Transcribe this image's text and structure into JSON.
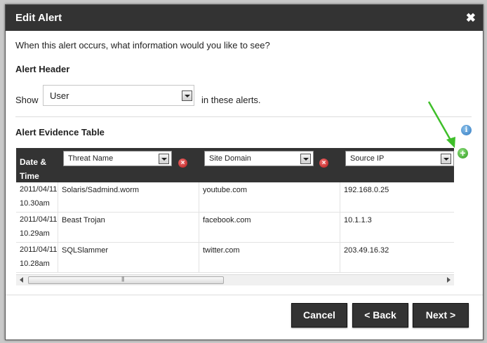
{
  "dialog": {
    "title": "Edit Alert",
    "close_label": "✖",
    "prompt": "When this alert occurs, what information would you like to see?"
  },
  "alert_header": {
    "title": "Alert Header",
    "show_label": "Show",
    "selected": "User",
    "after_label": "in these alerts."
  },
  "evidence_table": {
    "title": "Alert Evidence Table",
    "date_header": "Date & Time",
    "columns": [
      "Threat Name",
      "Site Domain",
      "Source IP"
    ],
    "rows": [
      {
        "date": "2011/04/11",
        "time": "10.30am",
        "threat": "Solaris/Sadmind.worm",
        "domain": "youtube.com",
        "ip": "192.168.0.25"
      },
      {
        "date": "2011/04/11",
        "time": "10.29am",
        "threat": "Beast Trojan",
        "domain": "facebook.com",
        "ip": "10.1.1.3"
      },
      {
        "date": "2011/04/11",
        "time": "10.28am",
        "threat": "SQLSlammer",
        "domain": "twitter.com",
        "ip": "203.49.16.32"
      }
    ]
  },
  "buttons": {
    "cancel": "Cancel",
    "back": "< Back",
    "next": "Next >"
  },
  "icons": {
    "info": "info-icon",
    "add": "add-column-icon",
    "remove": "remove-column-icon",
    "arrow": "green-arrow-annotation"
  },
  "colors": {
    "title_bar": "#333333",
    "add": "#2e9a1c",
    "remove": "#b81b1b",
    "info": "#2f79c1",
    "arrow": "#3fbf2a"
  }
}
